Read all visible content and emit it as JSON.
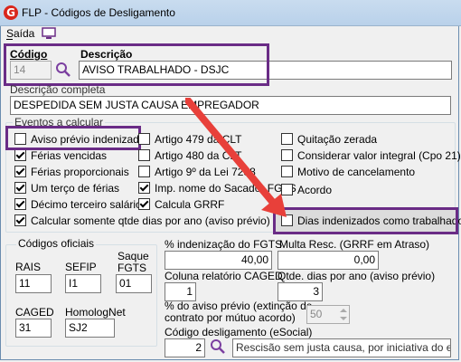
{
  "window": {
    "title": "FLP - Códigos de Desligamento"
  },
  "menu": {
    "saida": "Saída"
  },
  "codigo": {
    "label": "Código",
    "value": "14"
  },
  "descricao": {
    "label": "Descrição",
    "value": "AVISO TRABALHADO - DSJC"
  },
  "descricao_completa": {
    "label": "Descrição completa",
    "value": "DESPEDIDA SEM JUSTA CAUSA EMPREGADOR"
  },
  "eventos": {
    "label": "Eventos a calcular",
    "col1": [
      {
        "label": "Aviso prévio indenizado",
        "checked": false
      },
      {
        "label": "Férias vencidas",
        "checked": true
      },
      {
        "label": "Férias proporcionais",
        "checked": true
      },
      {
        "label": "Um terço de férias",
        "checked": true
      },
      {
        "label": "Décimo terceiro salário",
        "checked": true
      },
      {
        "label": "Calcular somente qtde dias por ano (aviso prévio)",
        "checked": true
      }
    ],
    "col2": [
      {
        "label": "Artigo 479 da CLT",
        "checked": false
      },
      {
        "label": "Artigo 480 da CLT",
        "checked": false
      },
      {
        "label": "Artigo 9º da Lei 7238",
        "checked": false
      },
      {
        "label": "Imp. nome do Sacador FGTS",
        "checked": true
      },
      {
        "label": "Calcula GRRF",
        "checked": true
      }
    ],
    "col3": [
      {
        "label": "Quitação zerada",
        "checked": false
      },
      {
        "label": "Considerar valor integral (Cpo 21)",
        "checked": false
      },
      {
        "label": "Motivo de cancelamento",
        "checked": false
      },
      {
        "label": "Acordo",
        "checked": false
      }
    ],
    "dias_indenizados": {
      "label": "Dias indenizados como trabalhados",
      "checked": false
    }
  },
  "codigos_oficiais": {
    "label": "Códigos oficiais",
    "rais": {
      "label": "RAIS",
      "value": "11"
    },
    "sefip": {
      "label": "SEFIP",
      "value": "I1"
    },
    "saque_fgts": {
      "label_line1": "Saque",
      "label_line2": "FGTS",
      "value": "01"
    },
    "caged": {
      "label": "CAGED",
      "value": "31"
    },
    "homolognet": {
      "label": "HomologNet",
      "value": "SJ2"
    }
  },
  "pct_indenizacao": {
    "label": "% indenização do FGTS",
    "value": "40,00"
  },
  "multa_resc": {
    "label": "Multa Resc. (GRRF em Atraso)",
    "value": "0,00"
  },
  "coluna_caged": {
    "label": "Coluna relatório CAGED",
    "value": "1"
  },
  "qtde_dias": {
    "label": "Qtde. dias por ano (aviso prévio)",
    "value": "3"
  },
  "pct_aviso": {
    "label_line1": "% do aviso prévio (extinção de",
    "label_line2": "contrato por mútuo acordo)",
    "value": "50"
  },
  "codigo_desligamento": {
    "label": "Código desligamento (eSocial)",
    "value": "2",
    "desc": "Rescisão sem justa causa, por iniciativa do empre"
  },
  "colors": {
    "highlight": "#6a2c86",
    "arrow": "#e8403a"
  }
}
